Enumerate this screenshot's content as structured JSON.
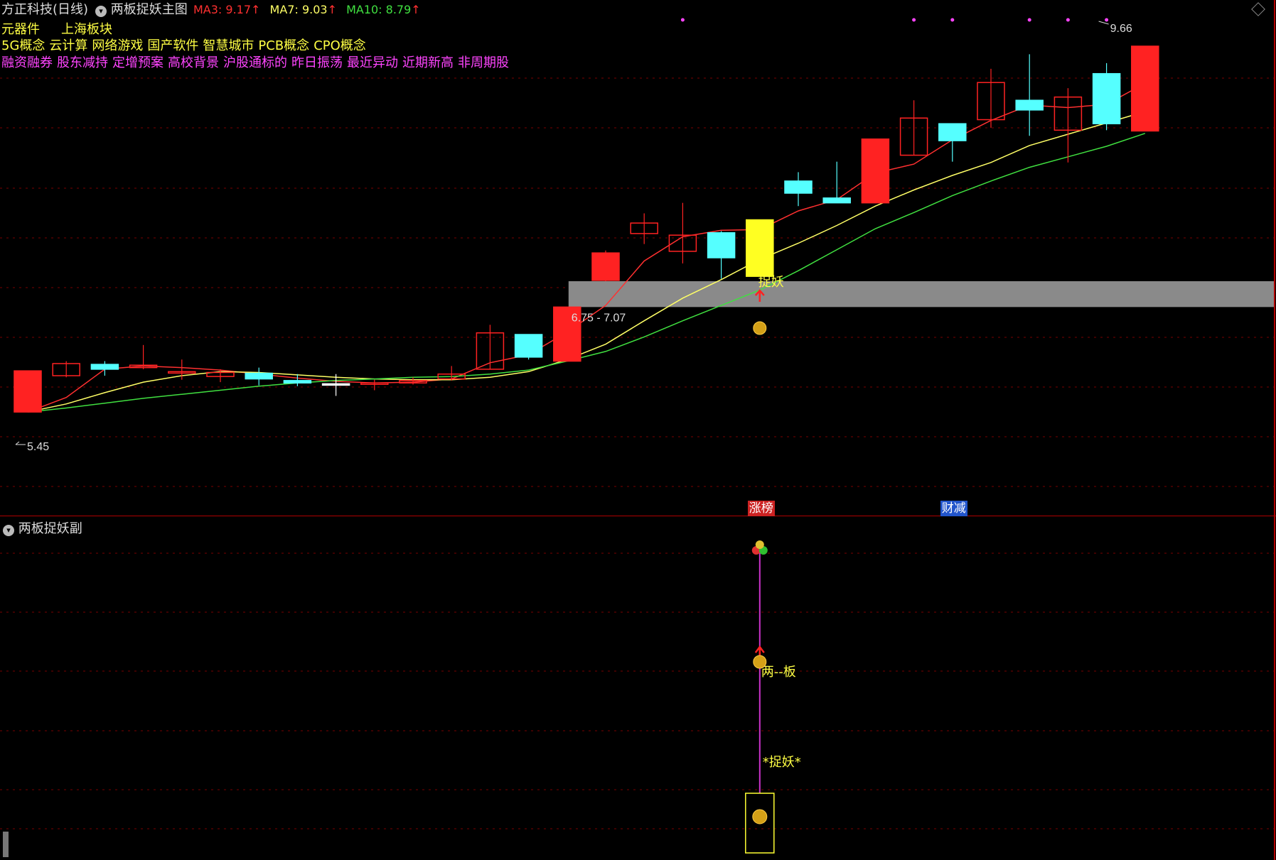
{
  "header": {
    "stock_name": "方正科技(日线)",
    "indicator_name": "两板捉妖主图",
    "ma3_label": "MA3: 9.17",
    "ma7_label": "MA7: 9.03",
    "ma10_label": "MA10: 8.79",
    "arrow": "↑",
    "ma3_color": "#ff3030",
    "ma7_color": "#ffff66",
    "ma10_color": "#40e040"
  },
  "tags": {
    "line1": [
      "元器件",
      "上海板块"
    ],
    "line2": [
      "5G概念",
      "云计算",
      "网络游戏",
      "国产软件",
      "智慧城市",
      "PCB概念",
      "CPO概念"
    ],
    "line3": [
      "融资融券",
      "股东减持",
      "定增预案",
      "高校背景",
      "沪股通标的",
      "昨日振荡",
      "最近异动",
      "近期新高",
      "非周期股"
    ]
  },
  "main_chart": {
    "ylim": [
      5.1,
      10.2
    ],
    "high_label": "9.66",
    "low_label": "5.45",
    "zone_label": "6.75 - 7.07",
    "zone": [
      6.75,
      7.07
    ],
    "signal_label": "捉妖",
    "candles": [
      {
        "o": 5.45,
        "c": 5.96,
        "h": 5.96,
        "l": 5.45
      },
      {
        "o": 5.9,
        "c": 6.05,
        "h": 6.08,
        "l": 5.88
      },
      {
        "o": 6.04,
        "c": 5.98,
        "h": 6.08,
        "l": 5.9
      },
      {
        "o": 6.0,
        "c": 6.03,
        "h": 6.28,
        "l": 5.98
      },
      {
        "o": 5.95,
        "c": 5.95,
        "h": 6.1,
        "l": 5.85
      },
      {
        "o": 5.89,
        "c": 5.94,
        "h": 5.98,
        "l": 5.82
      },
      {
        "o": 5.93,
        "c": 5.86,
        "h": 6.0,
        "l": 5.78
      },
      {
        "o": 5.84,
        "c": 5.81,
        "h": 5.92,
        "l": 5.77
      },
      {
        "o": 5.8,
        "c": 5.8,
        "h": 5.92,
        "l": 5.65
      },
      {
        "o": 5.81,
        "c": 5.81,
        "h": 5.85,
        "l": 5.72
      },
      {
        "o": 5.81,
        "c": 5.84,
        "h": 5.88,
        "l": 5.79
      },
      {
        "o": 5.86,
        "c": 5.92,
        "h": 6.02,
        "l": 5.84
      },
      {
        "o": 5.98,
        "c": 6.43,
        "h": 6.53,
        "l": 5.98
      },
      {
        "o": 6.41,
        "c": 6.13,
        "h": 6.41,
        "l": 6.1
      },
      {
        "o": 6.08,
        "c": 6.75,
        "h": 6.75,
        "l": 6.08
      },
      {
        "o": 7.08,
        "c": 7.42,
        "h": 7.45,
        "l": 7.07
      },
      {
        "o": 7.66,
        "c": 7.79,
        "h": 7.91,
        "l": 7.53
      },
      {
        "o": 7.44,
        "c": 7.64,
        "h": 8.04,
        "l": 7.29
      },
      {
        "o": 7.36,
        "c": 7.67,
        "h": 7.69,
        "l": 7.1
      },
      {
        "o": 7.13,
        "c": 7.83,
        "h": 7.83,
        "l": 7.13
      },
      {
        "o": 8.16,
        "c": 8.31,
        "h": 8.42,
        "l": 8.0
      },
      {
        "o": 8.04,
        "c": 8.1,
        "h": 8.55,
        "l": 8.04
      },
      {
        "o": 8.04,
        "c": 8.83,
        "h": 8.83,
        "l": 8.04
      },
      {
        "o": 9.09,
        "c": 8.63,
        "h": 9.31,
        "l": 8.63
      },
      {
        "o": 8.81,
        "c": 9.02,
        "h": 9.02,
        "l": 8.55
      },
      {
        "o": 9.07,
        "c": 9.53,
        "h": 9.7,
        "l": 8.97
      },
      {
        "o": 9.31,
        "c": 9.19,
        "h": 9.88,
        "l": 8.87
      },
      {
        "o": 9.35,
        "c": 8.94,
        "h": 9.46,
        "l": 8.54
      },
      {
        "o": 9.02,
        "c": 9.64,
        "h": 9.77,
        "l": 8.94
      },
      {
        "o": 8.93,
        "c": 9.98,
        "h": 9.98,
        "l": 8.93
      }
    ],
    "candle_styles": [
      "up-fill",
      "up",
      "down",
      "up",
      "up",
      "up",
      "down",
      "down",
      "cross",
      "up",
      "up",
      "up",
      "up",
      "down",
      "up-fill",
      "up-fill",
      "up",
      "up",
      "down",
      "yellow",
      "down",
      "down",
      "up-fill",
      "up",
      "down",
      "up",
      "down",
      "up",
      "down",
      "up-fill"
    ],
    "ma3": [
      5.45,
      5.63,
      5.98,
      6.02,
      6.0,
      5.97,
      5.92,
      5.87,
      5.83,
      5.81,
      5.82,
      5.86,
      6.06,
      6.16,
      6.44,
      6.77,
      7.32,
      7.62,
      7.7,
      7.71,
      7.94,
      8.08,
      8.41,
      8.52,
      8.82,
      9.06,
      9.25,
      9.22,
      9.26,
      9.52
    ],
    "ma7": [
      5.45,
      5.55,
      5.69,
      5.82,
      5.9,
      5.95,
      5.94,
      5.91,
      5.88,
      5.86,
      5.85,
      5.85,
      5.88,
      5.95,
      6.1,
      6.29,
      6.58,
      6.86,
      7.09,
      7.34,
      7.54,
      7.76,
      8.0,
      8.2,
      8.38,
      8.54,
      8.75,
      8.89,
      9.03,
      9.17
    ],
    "ma10": [
      5.45,
      5.5,
      5.56,
      5.62,
      5.67,
      5.72,
      5.77,
      5.81,
      5.84,
      5.86,
      5.88,
      5.89,
      5.92,
      5.97,
      6.08,
      6.2,
      6.38,
      6.58,
      6.77,
      6.96,
      7.2,
      7.46,
      7.72,
      7.92,
      8.13,
      8.31,
      8.48,
      8.61,
      8.74,
      8.9
    ],
    "dots_top": [
      17,
      23,
      24,
      26,
      27,
      28
    ],
    "bottom_badges": [
      {
        "text": "涨榜",
        "bg": "#cc2222",
        "idx": 19
      },
      {
        "text": "财减",
        "bg": "#2255cc",
        "idx": 24
      }
    ]
  },
  "sub_chart": {
    "title": "两板捉妖副",
    "label_liangban": "两--板",
    "label_zhuoyao": "*捉妖*",
    "signal_idx": 19,
    "line_color": "#cc33cc",
    "box_color": "#ffff33"
  },
  "colors": {
    "up": "#ff2222",
    "down": "#55ffff",
    "yellow": "#ffff22",
    "grid": "#7a0000",
    "separator": "#b00000",
    "zone": "#8a8a8a"
  }
}
